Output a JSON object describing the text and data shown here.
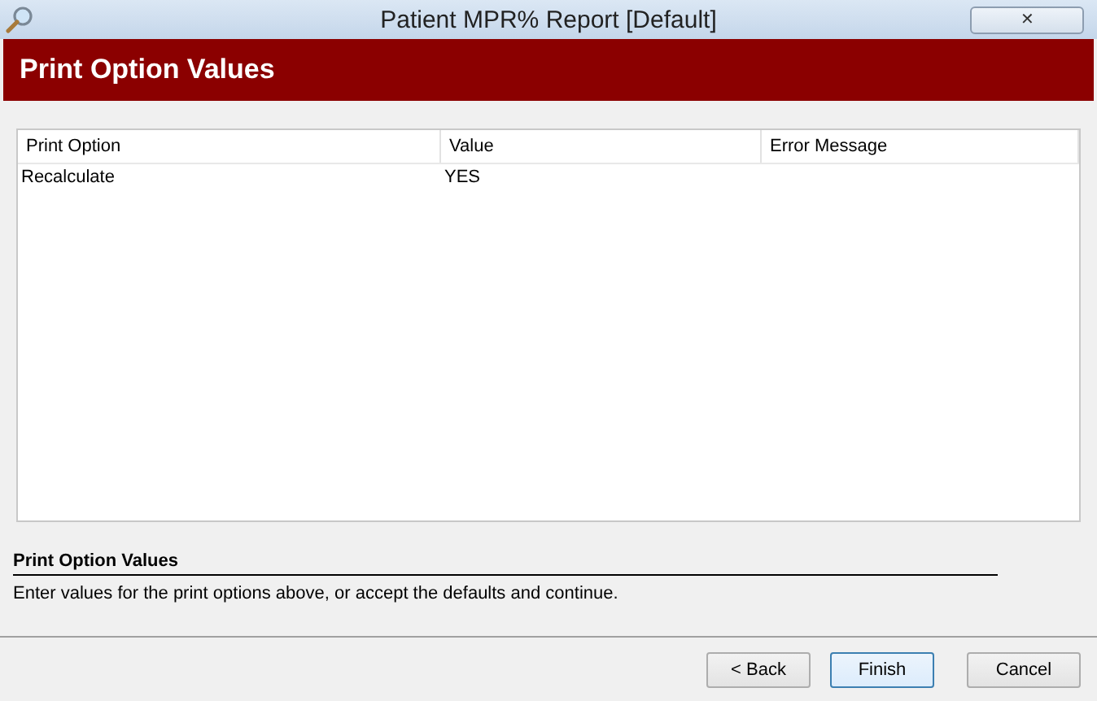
{
  "window": {
    "title": "Patient MPR% Report [Default]",
    "close": "✕"
  },
  "header": {
    "title": "Print Option Values"
  },
  "table": {
    "columns": [
      "Print Option",
      "Value",
      "Error Message"
    ],
    "rows": [
      [
        "Recalculate",
        "YES",
        ""
      ]
    ]
  },
  "help": {
    "title": "Print Option Values",
    "text": "Enter values for the print options above, or accept the defaults and continue."
  },
  "buttons": [
    {
      "label": "< Back",
      "default": false
    },
    {
      "label": "Finish",
      "default": true
    },
    {
      "label": "Cancel",
      "default": false
    }
  ]
}
